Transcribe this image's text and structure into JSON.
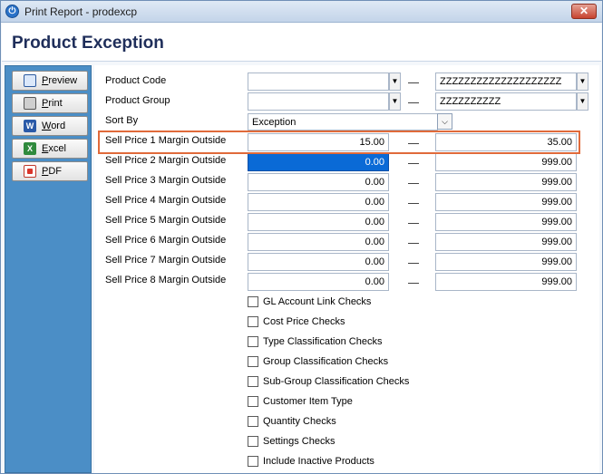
{
  "window": {
    "title": "Print Report - prodexcp",
    "close_glyph": "✕",
    "app_icon_glyph": "⏻"
  },
  "page": {
    "title": "Product Exception"
  },
  "sidebar": {
    "buttons": [
      {
        "label": "Preview",
        "icon": "preview-icon"
      },
      {
        "label": "Print",
        "icon": "printer-icon"
      },
      {
        "label": "Word",
        "icon": "word-icon",
        "glyph": "W"
      },
      {
        "label": "Excel",
        "icon": "excel-icon",
        "glyph": "X"
      },
      {
        "label": "PDF",
        "icon": "pdf-icon"
      }
    ]
  },
  "form": {
    "product_code": {
      "label": "Product Code",
      "from": "",
      "to": "ZZZZZZZZZZZZZZZZZZZZ"
    },
    "product_group": {
      "label": "Product Group",
      "from": "",
      "to": "ZZZZZZZZZZ"
    },
    "sort_by": {
      "label": "Sort By",
      "value": "Exception"
    },
    "dropdown_glyph": "▼",
    "chevron_glyph": "⌵",
    "margins": [
      {
        "label": "Sell Price 1 Margin Outside",
        "from": "15.00",
        "to": "35.00"
      },
      {
        "label": "Sell Price 2 Margin Outside",
        "from": "0.00",
        "to": "999.00"
      },
      {
        "label": "Sell Price 3 Margin Outside",
        "from": "0.00",
        "to": "999.00"
      },
      {
        "label": "Sell Price 4 Margin Outside",
        "from": "0.00",
        "to": "999.00"
      },
      {
        "label": "Sell Price 5 Margin Outside",
        "from": "0.00",
        "to": "999.00"
      },
      {
        "label": "Sell Price 6 Margin Outside",
        "from": "0.00",
        "to": "999.00"
      },
      {
        "label": "Sell Price 7 Margin Outside",
        "from": "0.00",
        "to": "999.00"
      },
      {
        "label": "Sell Price 8 Margin Outside",
        "from": "0.00",
        "to": "999.00"
      }
    ],
    "checks": [
      {
        "label": "GL Account Link Checks",
        "checked": false
      },
      {
        "label": "Cost Price Checks",
        "checked": false
      },
      {
        "label": "Type Classification Checks",
        "checked": false
      },
      {
        "label": "Group Classification Checks",
        "checked": false
      },
      {
        "label": "Sub-Group Classification Checks",
        "checked": false
      },
      {
        "label": "Customer Item Type",
        "checked": false
      },
      {
        "label": "Quantity Checks",
        "checked": false
      },
      {
        "label": "Settings Checks",
        "checked": false
      },
      {
        "label": "Include Inactive Products",
        "checked": false
      }
    ]
  },
  "colors": {
    "sidebar": "#4b8ec6",
    "highlight": "#e06a3a",
    "selection": "#0a6ad6",
    "title": "#1f2e5a"
  }
}
